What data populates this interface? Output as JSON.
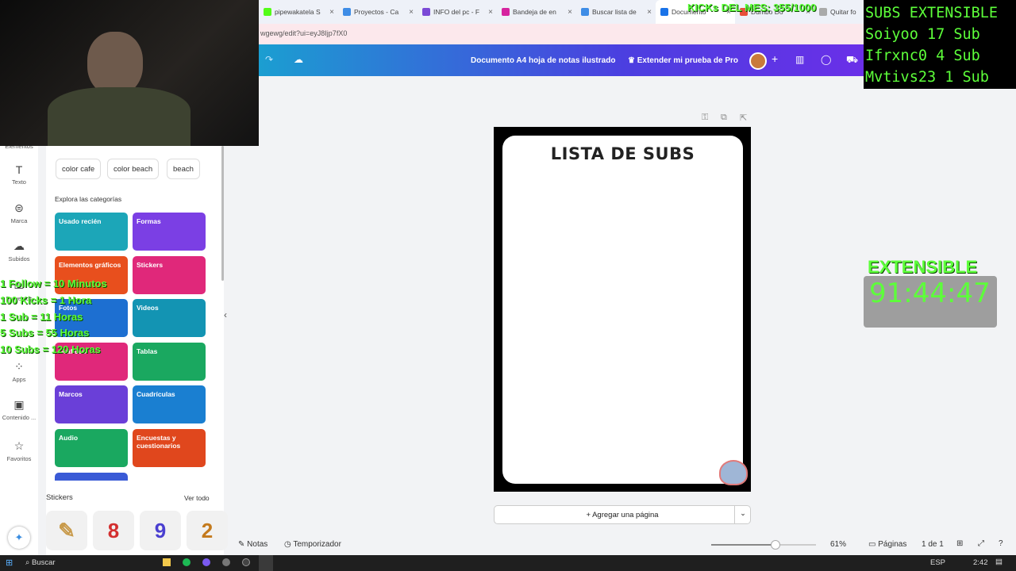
{
  "browser": {
    "tabs": [
      {
        "title": "pipewakatela S",
        "color": "#53fc18"
      },
      {
        "title": "Proyectos - Ca",
        "color": "#3f8de6"
      },
      {
        "title": "INFO del pc - F",
        "color": "#7b4ad6"
      },
      {
        "title": "Bandeja de en",
        "color": "#d6249f"
      },
      {
        "title": "Buscar lista de",
        "color": "#3f8de6"
      },
      {
        "title": "Documento",
        "color": "#1a73e8"
      },
      {
        "title": "Dumbo Do",
        "color": "#e84f3a"
      },
      {
        "title": "Quitar fo",
        "color": "#aaaaaa"
      }
    ],
    "url": "wgewg/edit?ui=eyJ8Ijp7fX0"
  },
  "canva": {
    "doc_title": "Documento A4 hoja de notas ilustrado",
    "pro_button": "Extender mi prueba de Pro",
    "rail": [
      {
        "label": "Elementos",
        "icon": "shapes-icon"
      },
      {
        "label": "Texto",
        "icon": "T"
      },
      {
        "label": "Marca",
        "icon": "brand-icon"
      },
      {
        "label": "Subidos",
        "icon": "cloud-icon"
      },
      {
        "label": "Proyectos",
        "icon": "folder-icon"
      },
      {
        "label": "Apps",
        "icon": "apps-icon"
      },
      {
        "label": "Contenido ...",
        "icon": "image-icon"
      },
      {
        "label": "Favoritos",
        "icon": "star-icon"
      }
    ],
    "chips": [
      "color cafe",
      "color beach",
      "beach"
    ],
    "explore_label": "Explora las categorías",
    "categories": [
      {
        "label": "Usado recién",
        "color": "#1ca6b8"
      },
      {
        "label": "Formas",
        "color": "#7b3fe4"
      },
      {
        "label": "Elementos gráficos",
        "color": "#e84f1d"
      },
      {
        "label": "Stickers",
        "color": "#e0287a"
      },
      {
        "label": "Fotos",
        "color": "#1d6fd1"
      },
      {
        "label": "Videos",
        "color": "#1394b3"
      },
      {
        "label": "Gráficos",
        "color": "#e0287a"
      },
      {
        "label": "Tablas",
        "color": "#1aa860"
      },
      {
        "label": "Marcos",
        "color": "#6a3fd8"
      },
      {
        "label": "Cuadrículas",
        "color": "#1a7fd1"
      },
      {
        "label": "Audio",
        "color": "#1aa860"
      },
      {
        "label": "Encuestas y cuestionarios",
        "color": "#e0471d"
      }
    ],
    "stickers_label": "Stickers",
    "see_all": "Ver todo",
    "sticker_items": [
      {
        "text": "✎",
        "color": "#c89a4a"
      },
      {
        "text": "8",
        "color": "#d32f2f"
      },
      {
        "text": "9",
        "color": "#4a3fd0"
      },
      {
        "text": "2",
        "color": "#c47a1d"
      }
    ],
    "page_title": "LISTA DE SUBS",
    "add_page": "+ Agregar una página",
    "notes": "Notas",
    "timer": "Temporizador",
    "zoom": "61%",
    "zoom_level": 0.61,
    "pages_label": "Páginas",
    "page_count": "1 de 1"
  },
  "taskbar": {
    "search": "Buscar",
    "lang": "ESP",
    "time": "2:42"
  },
  "overlays": {
    "kicks": "KICKs DEL MES: 355/1000",
    "subs_title": "SUBS EXTENSIBLE",
    "subs": [
      "Soiyoo 17 Sub",
      "Ifrxnc0 4 Sub",
      "Mvtivs23 1 Sub"
    ],
    "rules": [
      "1 Follow = 10 Minutos",
      "100 Kicks = 1 Hora",
      "1 Sub = 11 Horas",
      "5 Subs = 55 Horas",
      "10 Subs = 120 Horas"
    ],
    "extensible": "EXTENSIBLE",
    "timer": "91:44:47"
  }
}
